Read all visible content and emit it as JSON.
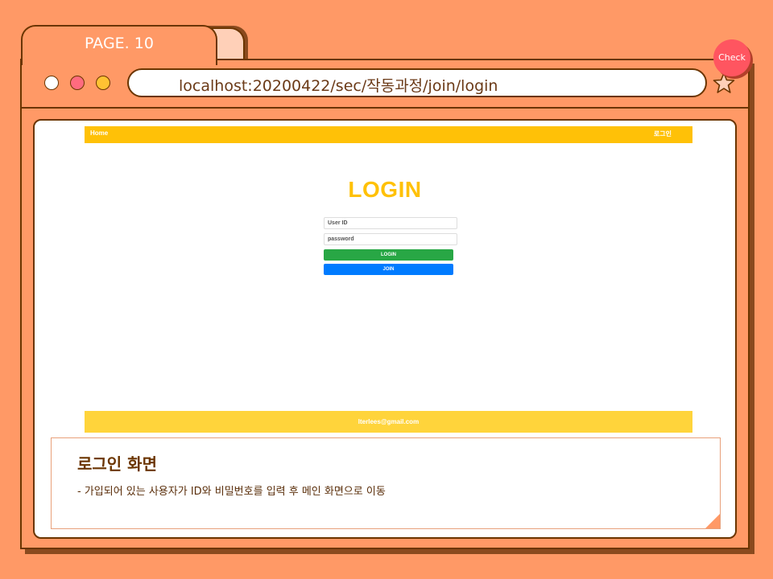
{
  "tab": {
    "label": "PAGE. 10"
  },
  "address_bar": {
    "url": "localhost:20200422/sec/작동과정/join/login"
  },
  "badge": {
    "label": "Check"
  },
  "site": {
    "nav": {
      "home": "Home",
      "login": "로그인"
    },
    "title": "LOGIN",
    "userid_placeholder": "User ID",
    "password_placeholder": "password",
    "login_button": "LOGIN",
    "join_button": "JOIN",
    "footer_email": "lterlees@gmail.com",
    "colors": {
      "nav": "#ffc107",
      "login": "#28a745",
      "join": "#007bff"
    }
  },
  "description": {
    "title": "로그인 화면",
    "text": "-   가입되어 있는 사용자가 ID와 비밀번호를 입력 후 메인 화면으로 이동"
  },
  "colors": {
    "background": "#ff9966",
    "outline": "#6b3500",
    "accent": "#ff5560"
  },
  "icons": [
    "star-icon"
  ]
}
